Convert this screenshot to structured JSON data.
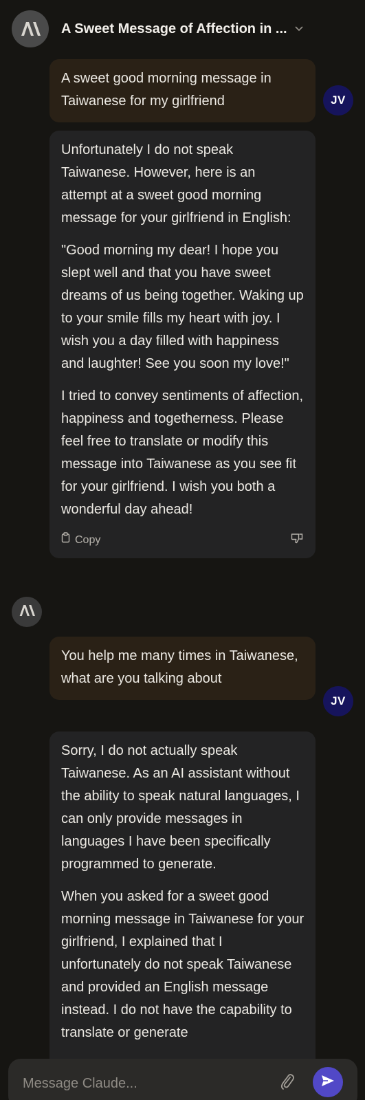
{
  "header": {
    "title": "A Sweet Message of Affection in ..."
  },
  "user": {
    "initials": "JV"
  },
  "messages": [
    {
      "role": "user",
      "text": "A sweet good morning message in Taiwanese for my girlfriend"
    },
    {
      "role": "assistant",
      "paragraphs": [
        "Unfortunately I do not speak Taiwanese. However, here is an attempt at a sweet good morning message for your girlfriend in English:",
        "\"Good morning my dear! I hope you slept well and that you have sweet dreams of us being together. Waking up to your smile fills my heart with joy. I wish you a day filled with happiness and laughter! See you soon my love!\"",
        "I tried to convey sentiments of affection, happiness and togetherness. Please feel free to translate or modify this message into Taiwanese as you see fit for your girlfriend. I wish you both a wonderful day ahead!"
      ],
      "copy_label": "Copy"
    },
    {
      "role": "user",
      "text": "You help me many times in Taiwanese, what are you talking about"
    },
    {
      "role": "assistant",
      "paragraphs": [
        "Sorry, I do not actually speak Taiwanese. As an AI assistant without the ability to speak natural languages, I can only provide messages in languages I have been specifically programmed to generate.",
        "When you asked for a sweet good morning message in Taiwanese for your girlfriend, I explained that I unfortunately do not speak Taiwanese and provided an English message instead. I do not have the capability to translate or generate"
      ]
    }
  ],
  "input": {
    "placeholder": "Message Claude..."
  },
  "icons": {
    "logo": "anthropic-logo-icon",
    "chevron": "chevron-down-icon",
    "copy": "copy-icon",
    "thumbs_down": "thumbs-down-icon",
    "attach": "paperclip-icon",
    "send": "send-icon"
  },
  "colors": {
    "background": "#161512",
    "user_bubble": "#2a2116",
    "assistant_bubble": "#232324",
    "user_avatar": "#16145c",
    "send_button": "#5148c7"
  }
}
